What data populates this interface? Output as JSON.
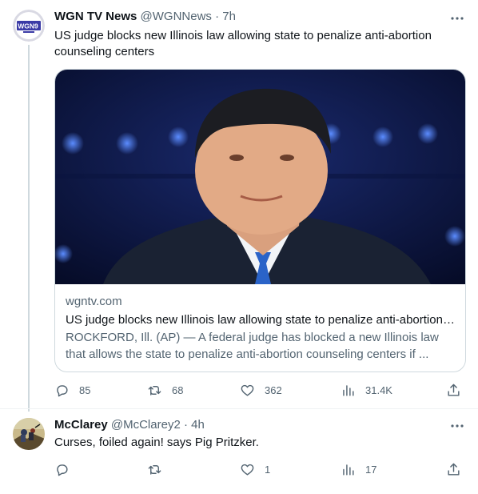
{
  "tweets": [
    {
      "name": "WGN TV News",
      "handle": "@WGNNews",
      "dot": "·",
      "time": "7h",
      "text": "US judge blocks new Illinois law allowing state to penalize anti-abortion counseling centers",
      "avatar_text": "WGN9",
      "card": {
        "domain": "wgntv.com",
        "title": "US judge blocks new Illinois law allowing state to penalize anti-abortion counseling centers",
        "description": "ROCKFORD, Ill. (AP) — A federal judge has blocked a new Illinois law that allows the state to penalize anti-abortion counseling centers if ..."
      },
      "actions": {
        "replies": "85",
        "retweets": "68",
        "likes": "362",
        "views": "31.4K"
      }
    },
    {
      "name": "McClarey",
      "handle": "@McClarey2",
      "dot": "·",
      "time": "4h",
      "text": "Curses, foiled again! says Pig Pritzker.",
      "actions": {
        "replies": "",
        "retweets": "",
        "likes": "1",
        "views": "17"
      }
    }
  ],
  "icons": {
    "more": "more-horizontal-icon",
    "reply": "reply-icon",
    "retweet": "retweet-icon",
    "like": "heart-icon",
    "views": "views-icon",
    "share": "share-icon"
  },
  "colors": {
    "text": "#0f1419",
    "secondary": "#536471",
    "border": "#cfd9de",
    "wgn_blue": "#3a3aa6"
  }
}
